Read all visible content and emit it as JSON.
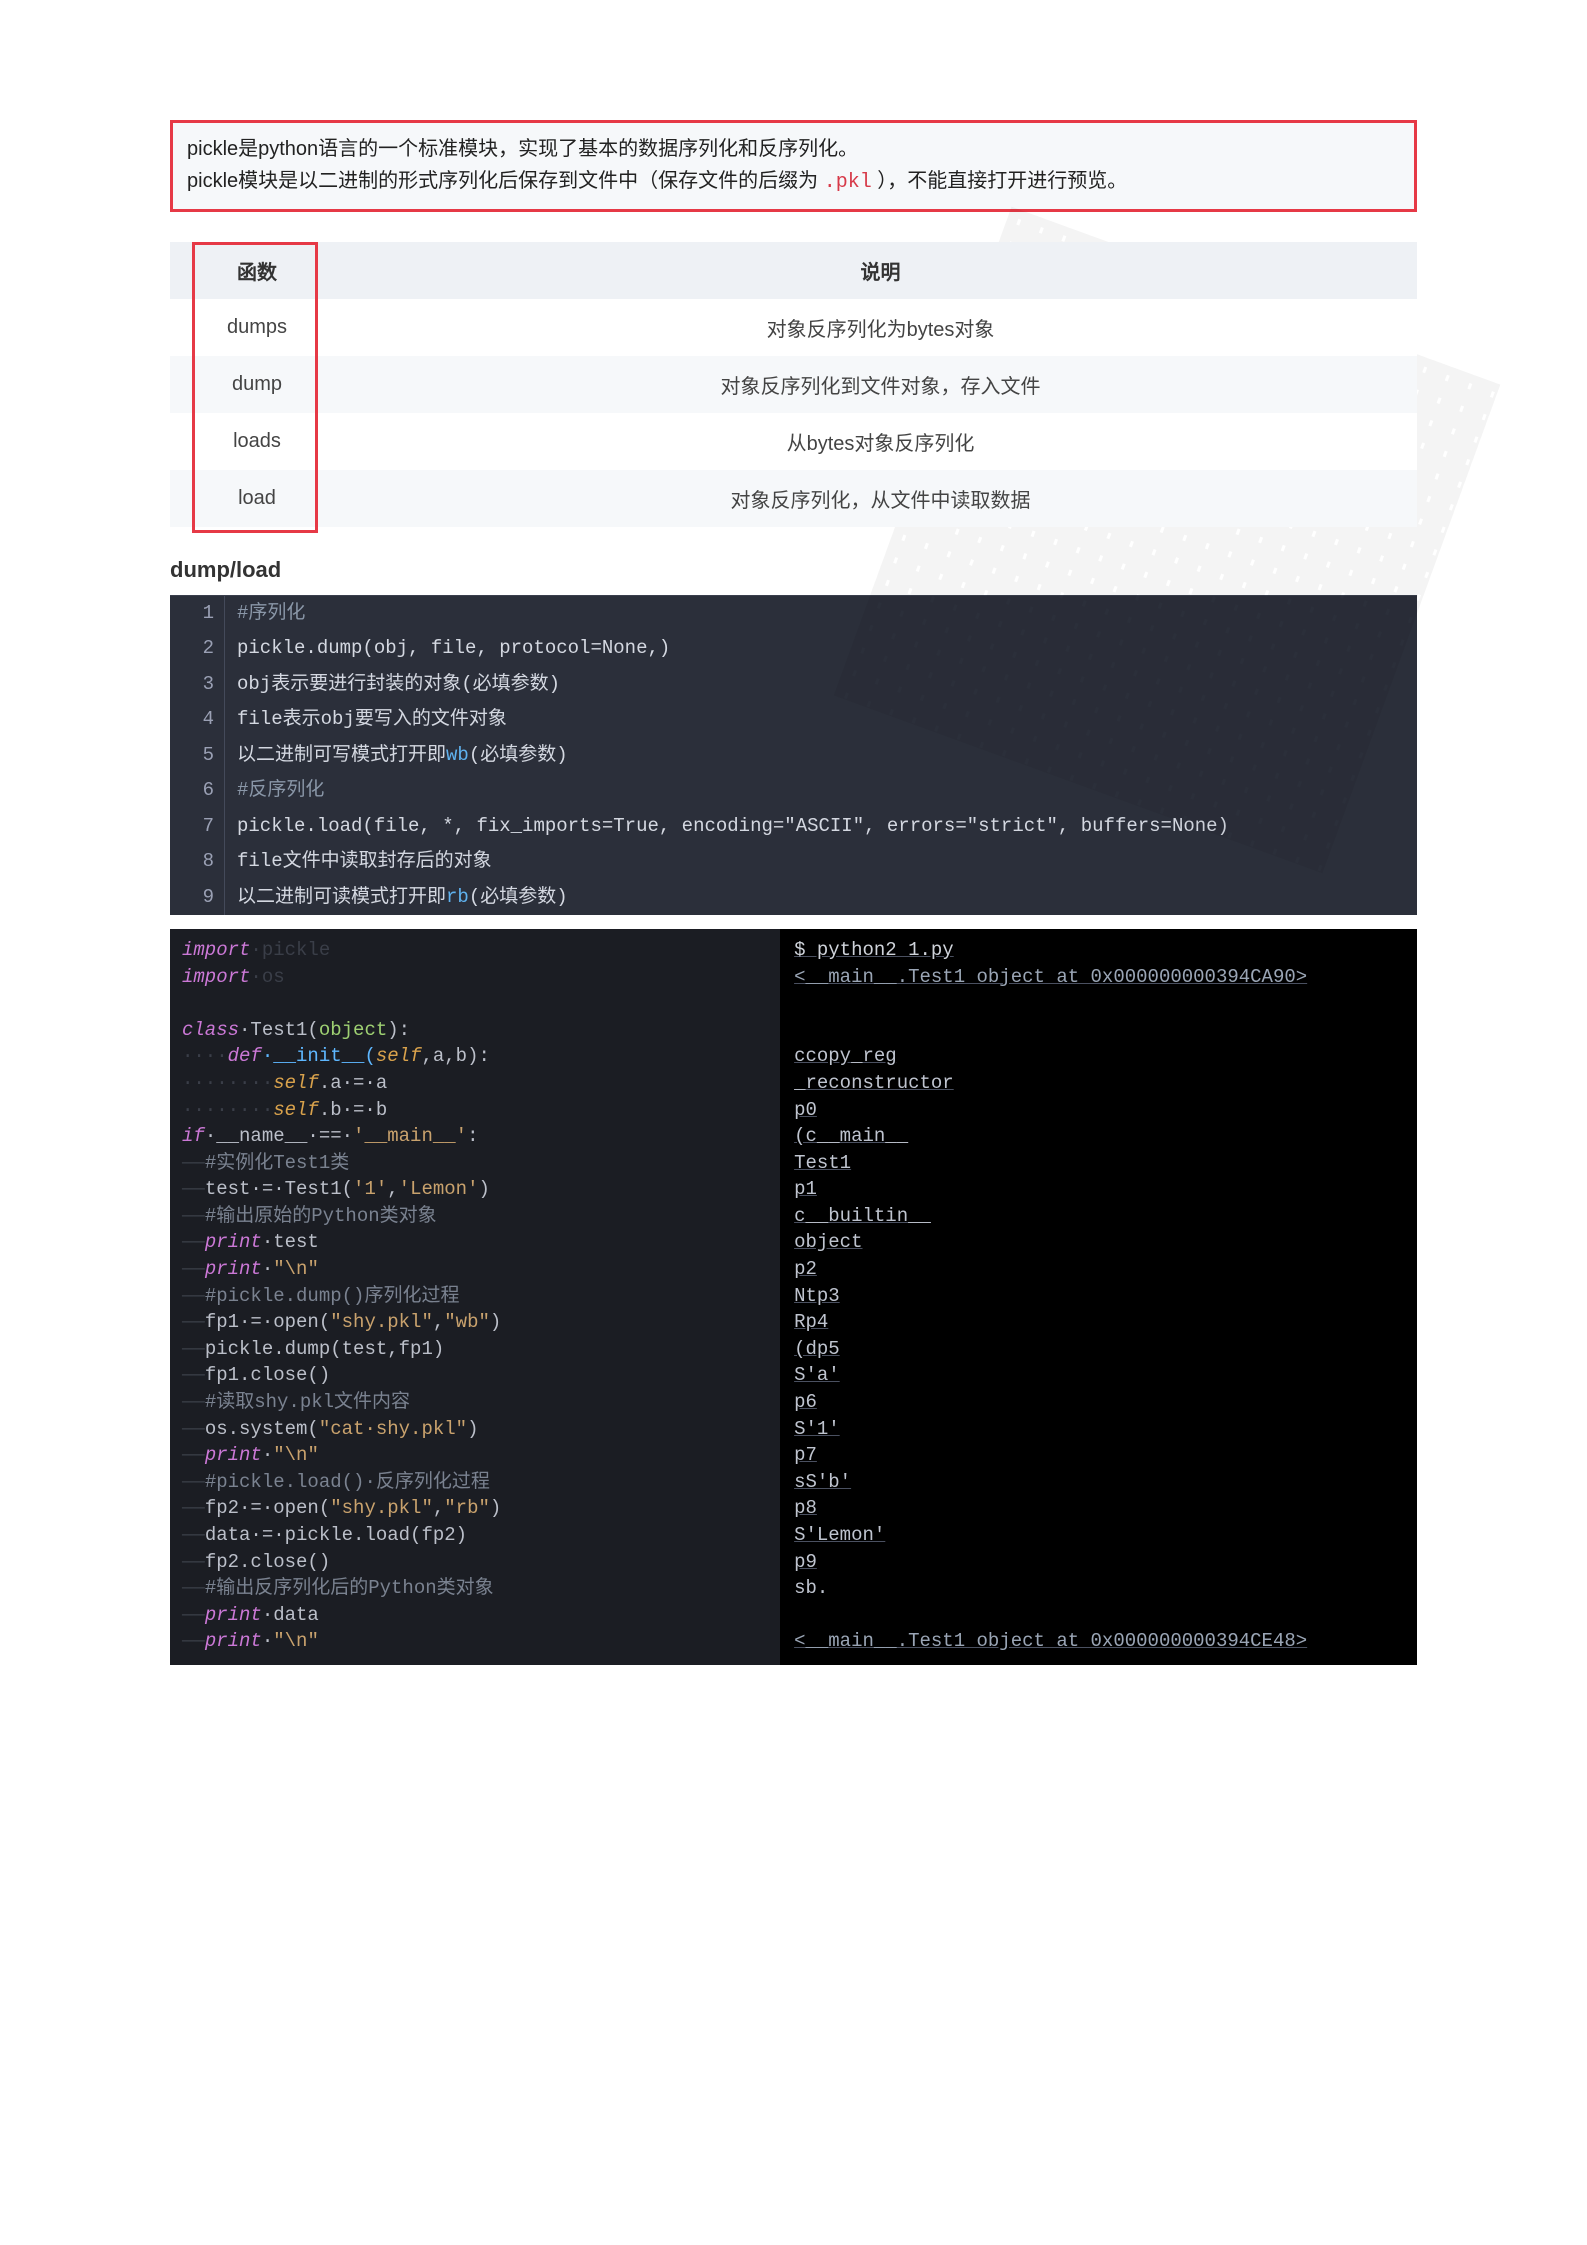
{
  "callout": {
    "line1_a": "pickle是python语言的一个标准模块，实现了基本的数据序列化和反序列化。",
    "line2_a": "pickle模块是以二进制的形式序列化后保存到文件中（保存文件的后缀为 ",
    "line2_code": ".pkl",
    "line2_b": " ），不能直接打开进行预览。"
  },
  "table": {
    "headers": {
      "fn": "函数",
      "desc": "说明"
    },
    "rows": [
      {
        "fn": "dumps",
        "desc": "对象反序列化为bytes对象"
      },
      {
        "fn": "dump",
        "desc": "对象反序列化到文件对象，存入文件"
      },
      {
        "fn": "loads",
        "desc": "从bytes对象反序列化"
      },
      {
        "fn": "load",
        "desc": "对象反序列化，从文件中读取数据"
      }
    ]
  },
  "section_title": "dump/load",
  "code1": {
    "lines": [
      {
        "n": "1",
        "plain": "",
        "comment": "#序列化"
      },
      {
        "n": "2",
        "plain": "pickle.dump(obj, file, protocol=None,)"
      },
      {
        "n": "3",
        "plain": "obj表示要进行封装的对象(必填参数)"
      },
      {
        "n": "4",
        "plain": "file表示obj要写入的文件对象"
      },
      {
        "n": "5",
        "pre": "以二进制可写模式打开即",
        "hi": "wb",
        "post": "(必填参数)"
      },
      {
        "n": "6",
        "plain": "",
        "comment": "#反序列化"
      },
      {
        "n": "7",
        "plain": "pickle.load(file, *, fix_imports=True, encoding=\"ASCII\", errors=\"strict\", buffers=None)"
      },
      {
        "n": "8",
        "plain": "file文件中读取封存后的对象"
      },
      {
        "n": "9",
        "pre": "以二进制可读模式打开即",
        "hi": "rb",
        "post": "(必填参数)"
      }
    ]
  },
  "left_code": {
    "l1a": "import",
    "l1b": "·pickle",
    "l2a": "import",
    "l2b": "·os",
    "blank1": "",
    "l3a": "class",
    "l3b": "·Test1(",
    "l3c": "object",
    "l3d": "):",
    "l4indent": "····",
    "l4a": "def",
    "l4b": "·__init__(",
    "l4c": "self",
    "l4d": ",a,b):",
    "l5indent": "········",
    "l5a": "self",
    "l5b": ".a·=·a",
    "l6indent": "········",
    "l6a": "self",
    "l6b": ".b·=·b",
    "l7a": "if",
    "l7b": "·__name__·==·",
    "l7c": "'__main__'",
    "l7d": ":",
    "l8dash": "——",
    "l8cmt": "#实例化Test1类",
    "l9dash": "——",
    "l9": "test·=·Test1(",
    "l9s1": "'1'",
    "l9c": ",",
    "l9s2": "'Lemon'",
    "l9e": ")",
    "l10dash": "——",
    "l10cmt": "#输出原始的Python类对象",
    "l11dash": "——",
    "l11a": "print",
    "l11b": "·test",
    "l12dash": "——",
    "l12a": "print",
    "l12b": "·",
    "l12s": "\"\\n\"",
    "l13dash": "——",
    "l13cmt": "#pickle.dump()序列化过程",
    "l14dash": "——",
    "l14": "fp1·=·open(",
    "l14s1": "\"shy.pkl\"",
    "l14c": ",",
    "l14s2": "\"wb\"",
    "l14e": ")",
    "l15dash": "——",
    "l15": "pickle.dump(test,fp1)",
    "l16dash": "——",
    "l16": "fp1.close()",
    "l17dash": "——",
    "l17cmt": "#读取shy.pkl文件内容",
    "l18dash": "——",
    "l18": "os.system(",
    "l18s": "\"cat·shy.pkl\"",
    "l18e": ")",
    "l19dash": "——",
    "l19a": "print",
    "l19b": "·",
    "l19s": "\"\\n\"",
    "l20dash": "——",
    "l20cmt": "#pickle.load()·反序列化过程",
    "l21dash": "——",
    "l21": "fp2·=·open(",
    "l21s1": "\"shy.pkl\"",
    "l21c": ",",
    "l21s2": "\"rb\"",
    "l21e": ")",
    "l22dash": "——",
    "l22": "data·=·pickle.load(fp2)",
    "l23dash": "——",
    "l23": "fp2.close()",
    "l24dash": "——",
    "l24cmt": "#输出反序列化后的Python类对象",
    "l25dash": "——",
    "l25a": "print",
    "l25b": "·data",
    "l26dash": "——",
    "l26a": "print",
    "l26b": "·",
    "l26s": "\"\\n\""
  },
  "right_out": {
    "r1": "$ python2 1.py",
    "r2": "<__main__.Test1 object at 0x000000000394CA90>",
    "blank": "",
    "r3": "ccopy_reg",
    "r4": "_reconstructor",
    "r5": "p0",
    "r6": "(c__main__",
    "r7": "Test1",
    "r8": "p1",
    "r9": "c__builtin__",
    "r10": "object",
    "r11": "p2",
    "r12": "Ntp3",
    "r13": "Rp4",
    "r14": "(dp5",
    "r15": "S'a'",
    "r16": "p6",
    "r17": "S'1'",
    "r18": "p7",
    "r19": "sS'b'",
    "r20": "p8",
    "r21": "S'Lemon'",
    "r22": "p9",
    "r23": "sb.",
    "r24": "<__main__.Test1 object at 0x000000000394CE48>"
  }
}
